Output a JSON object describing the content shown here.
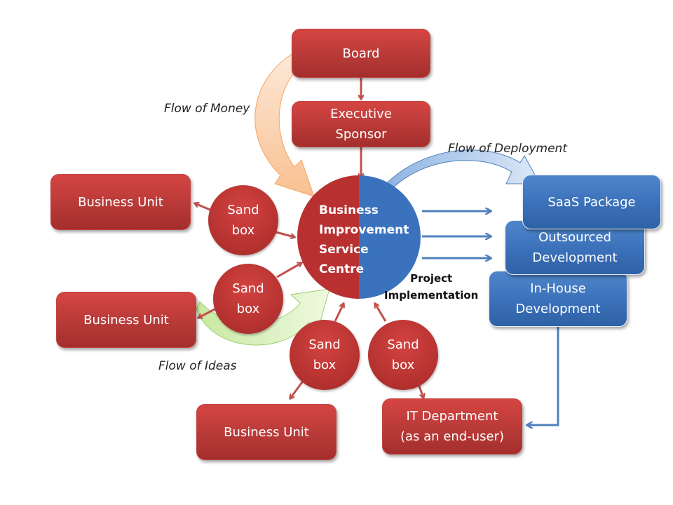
{
  "nodes": {
    "board": "Board",
    "executive_sponsor": [
      "Executive",
      "Sponsor"
    ],
    "hub": [
      "Business",
      "Improvement",
      "Service",
      "Centre"
    ],
    "business_unit_1": "Business Unit",
    "business_unit_2": "Business Unit",
    "business_unit_3": "Business Unit",
    "sandbox": [
      "Sand",
      "box"
    ],
    "saas_package": "SaaS Package",
    "outsourced_development": [
      "Outsourced",
      "Development"
    ],
    "inhouse_development": [
      "In-House",
      "Development"
    ],
    "it_department": [
      "IT Department",
      "(as an end-user)"
    ]
  },
  "labels": {
    "flow_of_money": "Flow of Money",
    "flow_of_deployment": "Flow of Deployment",
    "flow_of_ideas": "Flow of Ideas",
    "project_implementation": [
      "Project",
      "Implementation"
    ]
  },
  "colors": {
    "red_node": "#c0393a",
    "blue_node": "#3a70b8",
    "connector_red": "#c0504d",
    "connector_blue": "#4f81bd",
    "money_arrow": "#fbd5b5",
    "ideas_arrow": "#d7f0b8",
    "deployment_arrow": "#c6d9f1"
  }
}
